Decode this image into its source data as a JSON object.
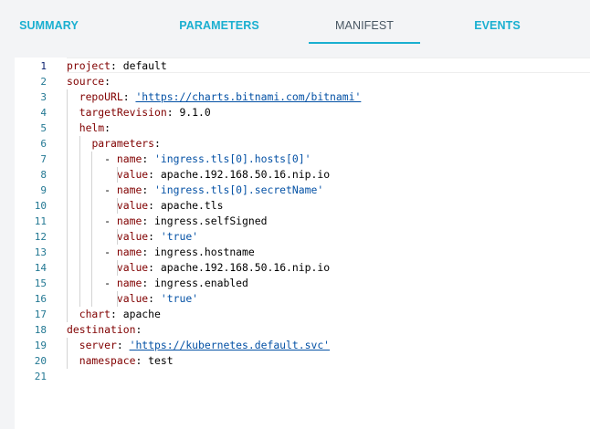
{
  "tabs": [
    {
      "label": "SUMMARY"
    },
    {
      "label": "PARAMETERS"
    },
    {
      "label": "MANIFEST"
    },
    {
      "label": "EVENTS"
    }
  ],
  "active_tab": "MANIFEST",
  "line_numbers": [
    "1",
    "2",
    "3",
    "4",
    "5",
    "6",
    "7",
    "8",
    "9",
    "10",
    "11",
    "12",
    "13",
    "14",
    "15",
    "16",
    "17",
    "18",
    "19",
    "20",
    "21"
  ],
  "manifest": {
    "l1": {
      "key": "project",
      "value": "default"
    },
    "l2": {
      "key": "source"
    },
    "l3": {
      "key": "repoURL",
      "value": "'https://charts.bitnami.com/bitnami'"
    },
    "l4": {
      "key": "targetRevision",
      "value": "9.1.0"
    },
    "l5": {
      "key": "helm"
    },
    "l6": {
      "key": "parameters"
    },
    "l7": {
      "key": "name",
      "value": "'ingress.tls[0].hosts[0]'"
    },
    "l8": {
      "key": "value",
      "value": "apache.192.168.50.16.nip.io"
    },
    "l9": {
      "key": "name",
      "value": "'ingress.tls[0].secretName'"
    },
    "l10": {
      "key": "value",
      "value": "apache.tls"
    },
    "l11": {
      "key": "name",
      "value": "ingress.selfSigned"
    },
    "l12": {
      "key": "value",
      "value": "'true'"
    },
    "l13": {
      "key": "name",
      "value": "ingress.hostname"
    },
    "l14": {
      "key": "value",
      "value": "apache.192.168.50.16.nip.io"
    },
    "l15": {
      "key": "name",
      "value": "ingress.enabled"
    },
    "l16": {
      "key": "value",
      "value": "'true'"
    },
    "l17": {
      "key": "chart",
      "value": "apache"
    },
    "l18": {
      "key": "destination"
    },
    "l19": {
      "key": "server",
      "value": "'https://kubernetes.default.svc'"
    },
    "l20": {
      "key": "namespace",
      "value": "test"
    }
  },
  "punct": {
    "colon": ":",
    "colon_sp": ": ",
    "dash": "- "
  },
  "colors": {
    "tab_accent": "#1aafd0",
    "tab_active_text": "#495763",
    "yaml_key": "#800000",
    "yaml_string": "#0451a5",
    "line_number": "#237893"
  }
}
